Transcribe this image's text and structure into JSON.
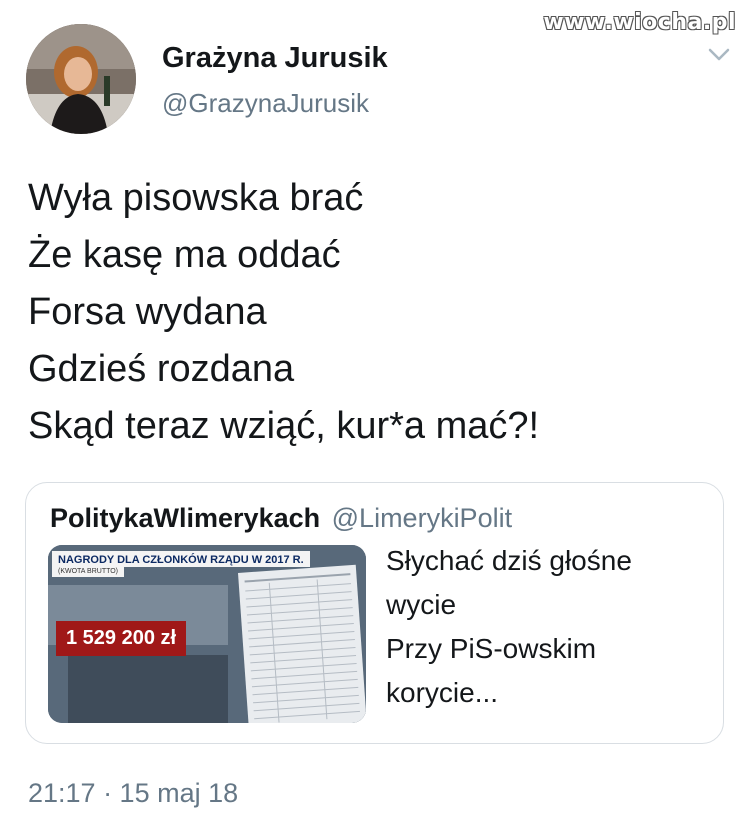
{
  "watermark": "www.wiocha.pl",
  "tweet": {
    "author_name": "Grażyna Jurusik",
    "author_handle": "@GrazynaJurusik",
    "lines": [
      "Wyła pisowska brać",
      "Że kasę ma oddać",
      "Forsa wydana",
      "Gdzieś rozdana",
      "Skąd teraz wziąć, kur*a mać?!"
    ],
    "timestamp": "21:17 · 15 maj 18"
  },
  "quoted": {
    "author_name": "PolitykaWlimerykach",
    "author_handle": "@LimerykiPolit",
    "image": {
      "title": "NAGRODY DLA CZŁONKÓW RZĄDU W 2017 R.",
      "subtitle": "(KWOTA BRUTTO)",
      "amount": "1 529 200 zł"
    },
    "lines": [
      "Słychać dziś głośne",
      "wycie",
      "Przy PiS-owskim",
      "korycie..."
    ]
  },
  "icons": {
    "menu": "chevron-down-icon",
    "avatar": "avatar"
  }
}
